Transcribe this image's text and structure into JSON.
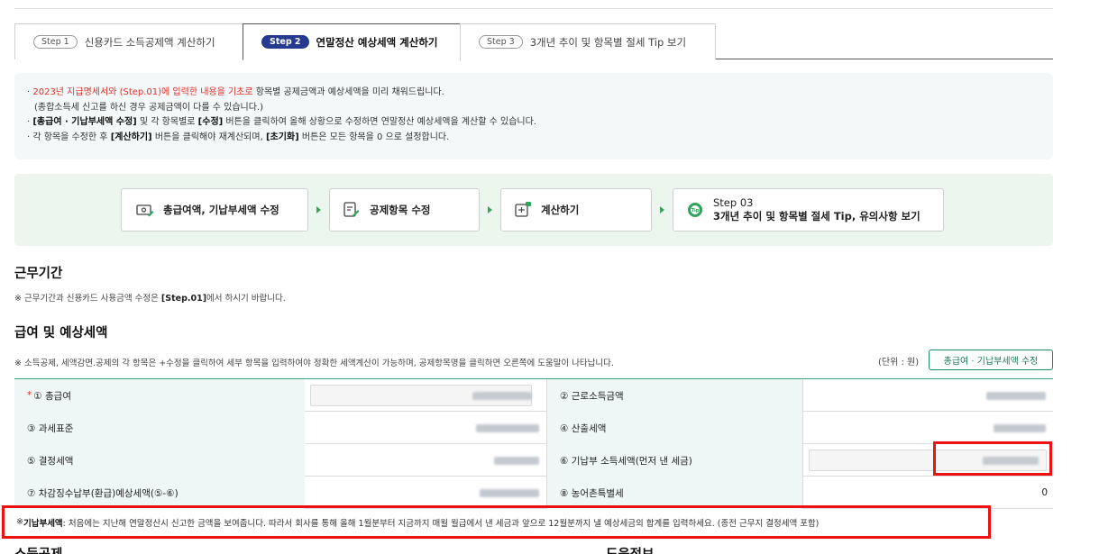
{
  "tabs": [
    {
      "step": "Step 1",
      "label": "신용카드 소득공제액 계산하기"
    },
    {
      "step": "Step 2",
      "label": "연말정산 예상세액 계산하기"
    },
    {
      "step": "Step 3",
      "label": "3개년 추이 및 항목별 절세 Tip 보기"
    }
  ],
  "notice": {
    "line1_red": "2023년 지급명세서와 (Step.01)에 입력한 내용을 기초로",
    "line1_rest": " 항목별 공제금액과 예상세액을 미리 채워드립니다.",
    "line2": "(종합소득세 신고를 하신 경우 공제금액이 다를 수 있습니다.)",
    "line3_b1": "[총급여 · 기납부세액 수정]",
    "line3_mid": " 및 각 항목별로 ",
    "line3_b2": "[수정]",
    "line3_rest": " 버튼을 클릭하여 올해 상황으로 수정하면 연말정산 예상세액을 계산할 수 있습니다.",
    "line4_a": "각 항목을 수정한 후 ",
    "line4_b1": "[계산하기]",
    "line4_mid": " 버튼을 클릭해야 재계산되며, ",
    "line4_b2": "[초기화]",
    "line4_rest": " 버튼은 모든 항목을 0 으로 설정합니다."
  },
  "flow": {
    "step1": "총급여액, 기납부세액 수정",
    "step2": "공제항목 수정",
    "step3": "계산하기",
    "step4_title": "Step 03",
    "step4_sub": "3개년 추이 및 항목별 절세 Tip, 유의사항 보기"
  },
  "work_period": {
    "title": "근무기간",
    "note_a": "※ 근무기간과 신용카드 사용금액 수정은 ",
    "note_b": "[Step.01]",
    "note_c": "에서 하시기 바랍니다."
  },
  "salary": {
    "title": "급여 및 예상세액",
    "desc": "※ 소득공제, 세액감면.공제의 각 항목은 +수정을 클릭하여 세부 항목을 입력하여야 정확한 세액계산이 가능하며, 공제항목명을 클릭하면 오른쪽에 도움말이 나타납니다.",
    "unit": "(단위 : 원)",
    "edit_button": "총급여 · 기납부세액 수정",
    "rows": [
      {
        "l1": "① 총급여",
        "l2": "② 근로소득금액"
      },
      {
        "l1": "③ 과세표준",
        "l2": "④ 산출세액"
      },
      {
        "l1": "⑤ 결정세액",
        "l2": "⑥ 기납부 소득세액(먼저 낸 세금)"
      },
      {
        "l1": "⑦ 차감징수납부(환급)예상세액(⑤-⑥)",
        "l2": "⑧ 농어촌특별세",
        "v2": "0"
      }
    ]
  },
  "footnote": {
    "a": "※ ",
    "b": "기납부세액",
    "c": " : 처음에는 지난해 연말정산시 신고한 금액을 보여줍니다. 따라서 회사를 통해 올해 1월분부터 지금까지 매월 월급에서 낸 세금과 앞으로 12월분까지 낼 예상세금의 합계를 입력하세요. (종전 근무지 결정세액 포함)"
  },
  "bottom": {
    "left": "소득공제",
    "right": "도움정보"
  },
  "colors": {
    "accent": "#233a8f",
    "green": "#1a8a6a",
    "red": "#e0302a"
  }
}
